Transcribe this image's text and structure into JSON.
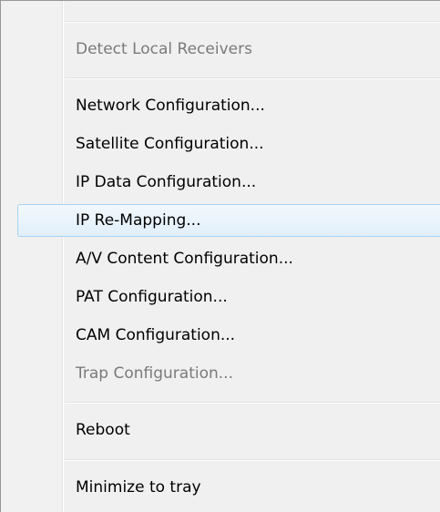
{
  "menu": {
    "items": [
      {
        "label": "Detect Local Receivers",
        "enabled": false
      },
      {
        "label": "Network Configuration...",
        "enabled": true
      },
      {
        "label": "Satellite Configuration...",
        "enabled": true
      },
      {
        "label": "IP Data Configuration...",
        "enabled": true
      },
      {
        "label": "IP Re-Mapping...",
        "enabled": true,
        "highlighted": true
      },
      {
        "label": "A/V Content Configuration...",
        "enabled": true
      },
      {
        "label": "PAT Configuration...",
        "enabled": true
      },
      {
        "label": "CAM Configuration...",
        "enabled": true
      },
      {
        "label": "Trap Configuration...",
        "enabled": false
      },
      {
        "label": "Reboot",
        "enabled": true
      },
      {
        "label": "Minimize to tray",
        "enabled": true
      }
    ]
  },
  "colors": {
    "highlight_border": "#a8d3f1",
    "highlight_fill": "#e1effa",
    "disabled_text": "#7a7a7a",
    "menu_background": "#f0f0f0"
  }
}
